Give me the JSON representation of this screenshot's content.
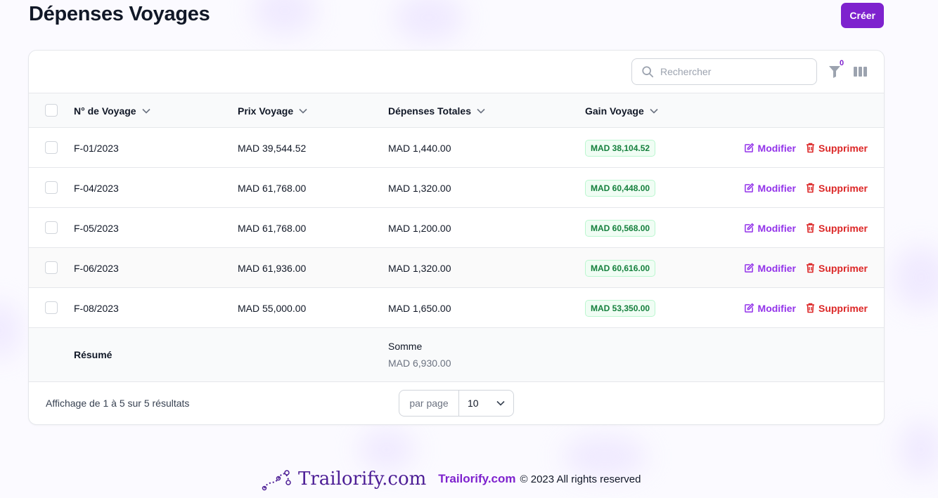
{
  "page": {
    "title": "Dépenses Voyages",
    "create_label": "Créer"
  },
  "toolbar": {
    "search_placeholder": "Rechercher",
    "filter_count": "0"
  },
  "table": {
    "columns": [
      {
        "label": "N° de Voyage"
      },
      {
        "label": "Prix Voyage"
      },
      {
        "label": "Dépenses Totales"
      },
      {
        "label": "Gain Voyage"
      }
    ],
    "rows": [
      {
        "voyage": "F-01/2023",
        "prix": "MAD 39,544.52",
        "depenses": "MAD 1,440.00",
        "gain": "MAD 38,104.52"
      },
      {
        "voyage": "F-04/2023",
        "prix": "MAD 61,768.00",
        "depenses": "MAD 1,320.00",
        "gain": "MAD 60,448.00"
      },
      {
        "voyage": "F-05/2023",
        "prix": "MAD 61,768.00",
        "depenses": "MAD 1,200.00",
        "gain": "MAD 60,568.00"
      },
      {
        "voyage": "F-06/2023",
        "prix": "MAD 61,936.00",
        "depenses": "MAD 1,320.00",
        "gain": "MAD 60,616.00"
      },
      {
        "voyage": "F-08/2023",
        "prix": "MAD 55,000.00",
        "depenses": "MAD 1,650.00",
        "gain": "MAD 53,350.00"
      }
    ],
    "edit_label": "Modifier",
    "delete_label": "Supprimer",
    "summary": {
      "label": "Résumé",
      "sum_title": "Somme",
      "sum_value": "MAD 6,930.00"
    }
  },
  "pagination": {
    "results_text": "Affichage de 1 à 5 sur 5 résultats",
    "per_page_label": "par page",
    "per_page_value": "10"
  },
  "footer": {
    "logo_text": "Trailorify.com",
    "link_text": "Trailorify.com",
    "copyright": "© 2023 All rights reserved"
  },
  "colors": {
    "accent": "#7e22ce",
    "danger": "#dc2626",
    "success": "#15803d"
  },
  "icons": [
    "search-icon",
    "filter-icon",
    "columns-icon",
    "chevron-down-icon",
    "edit-icon",
    "trash-icon",
    "trailorify-logo"
  ]
}
